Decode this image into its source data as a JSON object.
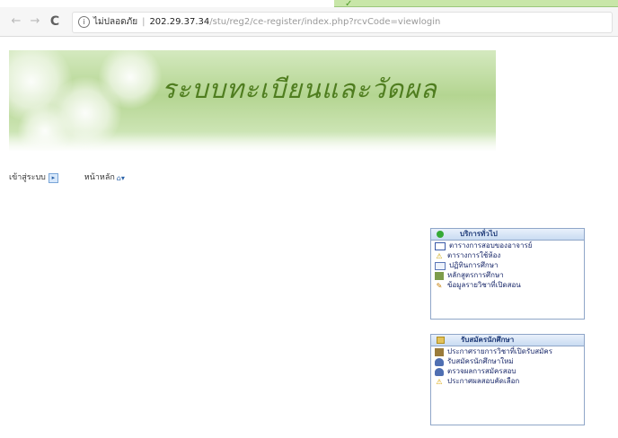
{
  "browser": {
    "info_label": "ไม่ปลอดภัย",
    "host": "202.29.37.34",
    "path": "/stu/reg2/ce-register/index.php?rcvCode=viewlogin"
  },
  "banner": {
    "title": "ระบบทะเบียนและวัดผล"
  },
  "topmenu": {
    "items": [
      {
        "label": "เข้าสู่ระบบ"
      },
      {
        "label": "หน้าหลัก"
      }
    ]
  },
  "panels": [
    {
      "title": "บริการทั่วไป",
      "items": [
        {
          "label": "ตารางการสอบของอาจารย์"
        },
        {
          "label": "ตารางการใช้ห้อง"
        },
        {
          "label": "ปฏิทินการศึกษา"
        },
        {
          "label": "หลักสูตรการศึกษา"
        },
        {
          "label": "ข้อมูลรายวิชาที่เปิดสอน"
        }
      ]
    },
    {
      "title": "รับสมัครนักศึกษา",
      "items": [
        {
          "label": "ประกาศรายการวิชาที่เปิดรับสมัคร"
        },
        {
          "label": "รับสมัครนักศึกษาใหม่"
        },
        {
          "label": "ตรวจผลการสมัครสอบ"
        },
        {
          "label": "ประกาศผลสอบคัดเลือก"
        }
      ]
    }
  ],
  "icons": {
    "panel1": [
      "calendar-icon",
      "warning-icon",
      "book-icon",
      "document-icon",
      "pen-icon"
    ],
    "panel2": [
      "grid-icon",
      "user-icon",
      "user-icon",
      "shield-icon"
    ]
  },
  "colors": {
    "banner_title": "#4f7d1f",
    "panel_border": "#8fa6c8",
    "panel_text": "#1b2a6b"
  }
}
